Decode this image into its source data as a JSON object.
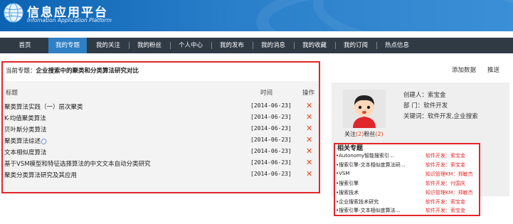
{
  "header": {
    "title": "信息应用平台",
    "subtitle": "Infomation Application Platform"
  },
  "nav": {
    "items": [
      {
        "label": "首页"
      },
      {
        "label": "我的专题"
      },
      {
        "label": "我的关注"
      },
      {
        "label": "我的粉丝"
      },
      {
        "label": "个人中心"
      },
      {
        "label": "我的发布"
      },
      {
        "label": "我的消息"
      },
      {
        "label": "我的收藏"
      },
      {
        "label": "我的订阅"
      },
      {
        "label": "热点信息"
      }
    ],
    "active": "我的专题"
  },
  "topic": {
    "label": "当前专题：",
    "value": "企业搜索中的聚类和分类算法研究对比"
  },
  "actions": {
    "add_data": "添加数据",
    "push": "推送"
  },
  "table": {
    "headers": {
      "title": "标题",
      "time": "时间",
      "op": "操作"
    },
    "rows": [
      {
        "title": "聚类算法实践（一）层次聚类",
        "date": "[2014-06-23]",
        "op": "✕",
        "attachment": false
      },
      {
        "title": "K-均值聚类算法",
        "date": "[2014-06-23]",
        "op": "✕",
        "attachment": false
      },
      {
        "title": "贝叶斯分类算法",
        "date": "[2014-06-23]",
        "op": "✕",
        "attachment": false
      },
      {
        "title": "聚类算法综述",
        "date": "[2014-06-23]",
        "op": "✕",
        "attachment": true
      },
      {
        "title": "文本相似度算法",
        "date": "[2014-06-23]",
        "op": "✕",
        "attachment": false
      },
      {
        "title": "基于VSM模型和特征选择算法的中文文本自动分类研究",
        "date": "[2014-06-23]",
        "op": "✕",
        "attachment": false
      },
      {
        "title": "聚类分类算法研究及其应用",
        "date": "[2014-06-23]",
        "op": "✕",
        "attachment": false
      }
    ]
  },
  "profile": {
    "follow_label": "关注",
    "follow_count": "(2)",
    "fans_label": "粉丝",
    "fans_count": "(2)",
    "creator": "创建人：索宝金",
    "department": "部  门：软件开发",
    "keywords": "关键词：软件开发,企业搜索"
  },
  "related": {
    "title": "相关专题",
    "items": [
      {
        "name": "•Autonomy智能搜索引…",
        "category": "软件开发：索宝金"
      },
      {
        "name": "•搜索引擎-文本相似度算法研…",
        "category": "软件开发：索宝金"
      },
      {
        "name": "•VSM",
        "category": "知识管理KM：郑敏杰"
      },
      {
        "name": "•搜索引擎",
        "category": "软件开发：付国庆"
      },
      {
        "name": "•搜索技术",
        "category": "知识管理KM：郑敏杰"
      },
      {
        "name": "•企业搜索技术研究",
        "category": "软件开发：索宝金"
      },
      {
        "name": "•搜索引擎-文本相似度算法…",
        "category": "软件开发：索宝金"
      }
    ]
  },
  "colors": {
    "header_blue": "#1a6fbd",
    "nav_bg": "#2f3a45",
    "nav_active": "#2e7fc4",
    "delete_red": "#e0461b",
    "highlight_red": "#e3262a"
  },
  "icons": {
    "logo": "globe-icon",
    "delete": "close-icon",
    "attachment": "paperclip-icon",
    "avatar": "cartoon-avatar"
  }
}
